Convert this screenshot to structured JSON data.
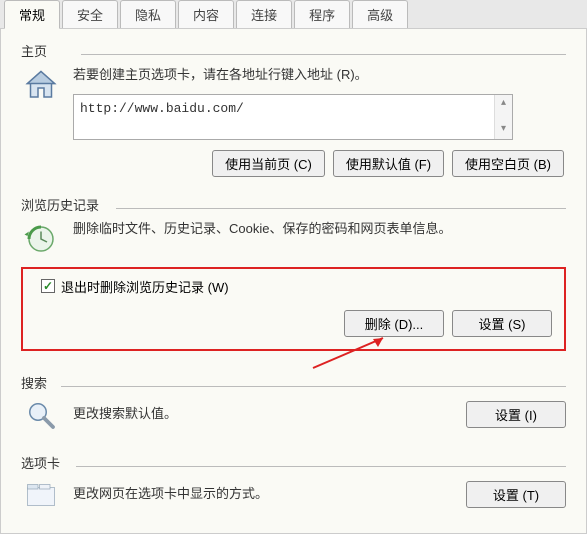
{
  "tabs": {
    "items": [
      {
        "label": "常规"
      },
      {
        "label": "安全"
      },
      {
        "label": "隐私"
      },
      {
        "label": "内容"
      },
      {
        "label": "连接"
      },
      {
        "label": "程序"
      },
      {
        "label": "高级"
      }
    ]
  },
  "home": {
    "title": "主页",
    "desc": "若要创建主页选项卡，请在各地址行键入地址 (R)。",
    "url": "http://www.baidu.com/",
    "btn_current": "使用当前页 (C)",
    "btn_default": "使用默认值 (F)",
    "btn_blank": "使用空白页 (B)"
  },
  "history": {
    "title": "浏览历史记录",
    "desc": "删除临时文件、历史记录、Cookie、保存的密码和网页表单信息。",
    "checkbox_label": "退出时删除浏览历史记录 (W)",
    "btn_delete": "删除 (D)...",
    "btn_settings": "设置 (S)"
  },
  "search": {
    "title": "搜索",
    "desc": "更改搜索默认值。",
    "btn_settings": "设置 (I)"
  },
  "tabs_section": {
    "title": "选项卡",
    "desc": "更改网页在选项卡中显示的方式。",
    "btn_settings": "设置 (T)"
  }
}
